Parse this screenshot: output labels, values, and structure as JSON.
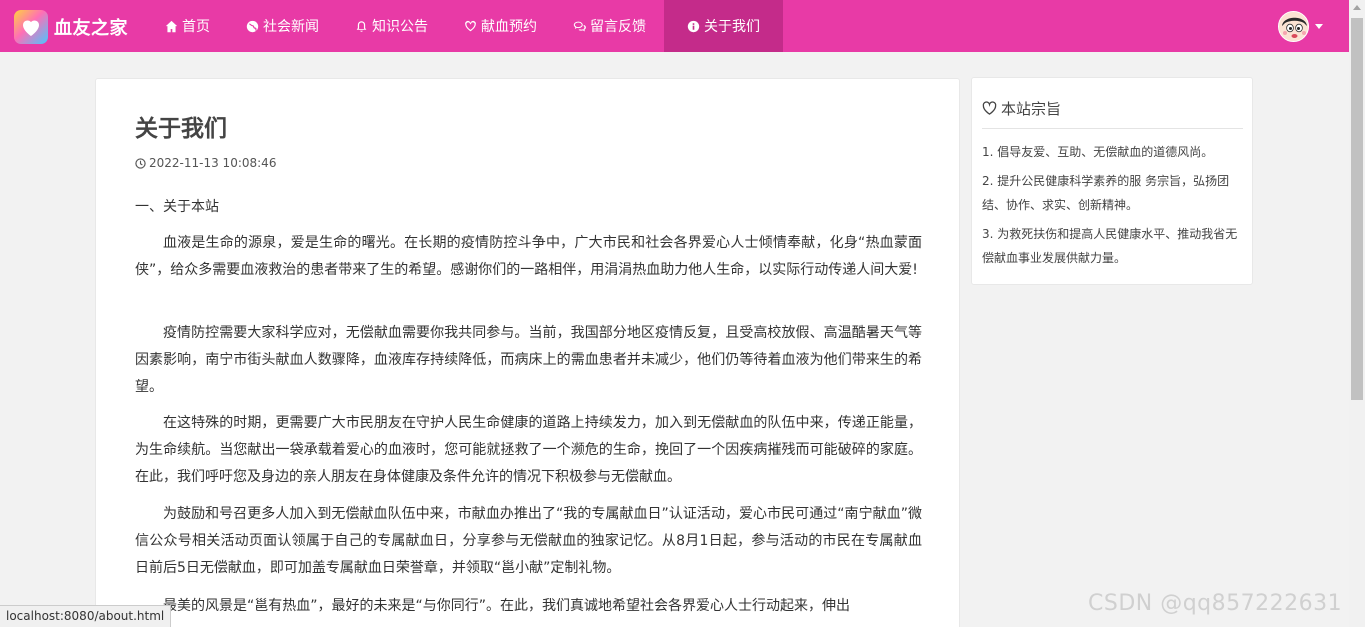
{
  "brand": {
    "name": "血友之家"
  },
  "nav": [
    {
      "label": "首页",
      "icon": "home-icon"
    },
    {
      "label": "社会新闻",
      "icon": "globe-icon"
    },
    {
      "label": "知识公告",
      "icon": "bell-icon"
    },
    {
      "label": "献血预约",
      "icon": "heart-icon"
    },
    {
      "label": "留言反馈",
      "icon": "comments-icon"
    },
    {
      "label": "关于我们",
      "icon": "info-icon",
      "active": true
    }
  ],
  "colors": {
    "navbar": "#e83aa6",
    "nav_active": "#c42b8a"
  },
  "article": {
    "title": "关于我们",
    "datetime": "2022-11-13 10:08:46",
    "section": "一、关于本站",
    "paragraphs": [
      "血液是生命的源泉，爱是生命的曙光。在长期的疫情防控斗争中，广大市民和社会各界爱心人士倾情奉献，化身“热血蒙面侠”，给众多需要血液救治的患者带来了生的希望。感谢你们的一路相伴，用涓涓热血助力他人生命，以实际行动传递人间大爱!",
      "疫情防控需要大家科学应对，无偿献血需要你我共同参与。当前，我国部分地区疫情反复，且受高校放假、高温酷暑天气等因素影响，南宁市街头献血人数骤降，血液库存持续降低，而病床上的需血患者并未减少，他们仍等待着血液为他们带来生的希望。",
      "在这特殊的时期，更需要广大市民朋友在守护人民生命健康的道路上持续发力，加入到无偿献血的队伍中来，传递正能量，为生命续航。当您献出一袋承载着爱心的血液时，您可能就拯救了一个濒危的生命，挽回了一个因疾病摧残而可能破碎的家庭。在此，我们呼吁您及身边的亲人朋友在身体健康及条件允许的情况下积极参与无偿献血。",
      "为鼓励和号召更多人加入到无偿献血队伍中来，市献血办推出了“我的专属献血日”认证活动，爱心市民可通过“南宁献血”微信公众号相关活动页面认领属于自己的专属献血日，分享参与无偿献血的独家记忆。从8月1日起，参与活动的市民在专属献血日前后5日无偿献血，即可加盖专属献血日荣誉章，并领取“邕小献”定制礼物。",
      "最美的风景是“邕有热血”，最好的未来是“与你同行”。在此，我们真诚地希望社会各界爱心人士行动起来，伸出"
    ]
  },
  "sidebar": {
    "title": "本站宗旨",
    "items": [
      "1. 倡导友爱、互助、无偿献血的道德风尚。",
      "2. 提升公民健康科学素养的服 务宗旨，弘扬团结、协作、求实、创新精神。",
      "3. 为救死扶伤和提高人民健康水平、推动我省无偿献血事业发展供献力量。"
    ]
  },
  "status_bar": {
    "url": "localhost:8080/about.html"
  },
  "watermark": "CSDN @qq857222631"
}
